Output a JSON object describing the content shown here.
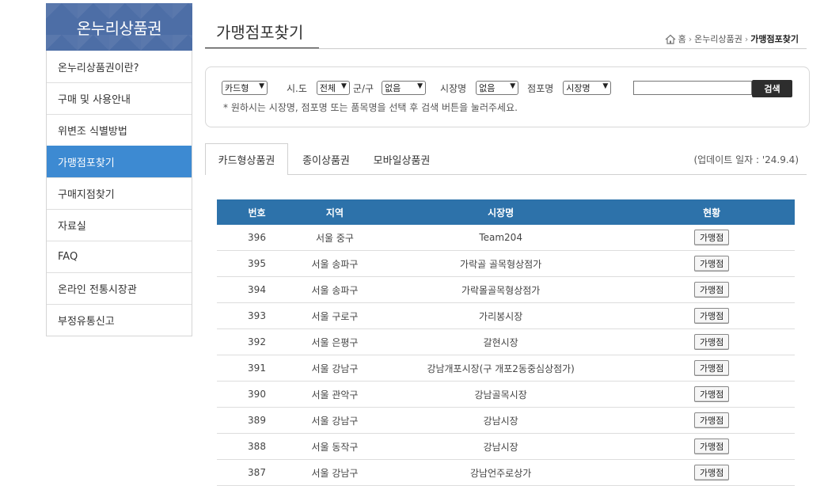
{
  "sidebar": {
    "header": "온누리상품권",
    "items": [
      {
        "label": "온누리상품권이란?"
      },
      {
        "label": "구매 및 사용안내"
      },
      {
        "label": "위변조 식별방법"
      },
      {
        "label": "가맹점포찾기"
      },
      {
        "label": "구매지점찾기"
      },
      {
        "label": "자료실"
      },
      {
        "label": "FAQ"
      },
      {
        "label": "온라인 전통시장관"
      },
      {
        "label": "부정유통신고"
      }
    ]
  },
  "page": {
    "title": "가맹점포찾기",
    "breadcrumb": {
      "home": "홈",
      "section": "온누리상품권",
      "current": "가맹점포찾기"
    }
  },
  "search": {
    "type_value": "카드형",
    "sido_label": "시.도",
    "sido_value": "전체",
    "gungu_label": "군/구",
    "gungu_value": "없음",
    "market_label": "시장명",
    "market_value": "없음",
    "store_label": "점포명",
    "store_value": "시장명",
    "input_value": "",
    "button_label": "검색",
    "hint": "* 원하시는 시장명, 점포명 또는 품목명을 선택 후 검색 버튼을 눌러주세요."
  },
  "tabs": [
    {
      "label": "카드형상품권"
    },
    {
      "label": "종이상품권"
    },
    {
      "label": "모바일상품권"
    }
  ],
  "update_text": "(업데이트 일자 : '24.9.4)",
  "table": {
    "headers": [
      "번호",
      "지역",
      "시장명",
      "현황"
    ],
    "rows": [
      {
        "no": "396",
        "region": "서울 중구",
        "market": "Team204",
        "status": "가맹점"
      },
      {
        "no": "395",
        "region": "서울 송파구",
        "market": "가락골 골목형상점가",
        "status": "가맹점"
      },
      {
        "no": "394",
        "region": "서울 송파구",
        "market": "가락몰골목형상점가",
        "status": "가맹점"
      },
      {
        "no": "393",
        "region": "서울 구로구",
        "market": "가리봉시장",
        "status": "가맹점"
      },
      {
        "no": "392",
        "region": "서울 은평구",
        "market": "갈현시장",
        "status": "가맹점"
      },
      {
        "no": "391",
        "region": "서울 강남구",
        "market": "강남개포시장(구 개포2동중심상점가)",
        "status": "가맹점"
      },
      {
        "no": "390",
        "region": "서울 관악구",
        "market": "강남골목시장",
        "status": "가맹점"
      },
      {
        "no": "389",
        "region": "서울 강남구",
        "market": "강남시장",
        "status": "가맹점"
      },
      {
        "no": "388",
        "region": "서울 동작구",
        "market": "강남시장",
        "status": "가맹점"
      },
      {
        "no": "387",
        "region": "서울 강남구",
        "market": "강남언주로상가",
        "status": "가맹점"
      }
    ]
  },
  "colors": {
    "sidebar_header": "#4d6ea6",
    "active_item": "#3d8ad2",
    "table_header": "#2d72aa"
  }
}
